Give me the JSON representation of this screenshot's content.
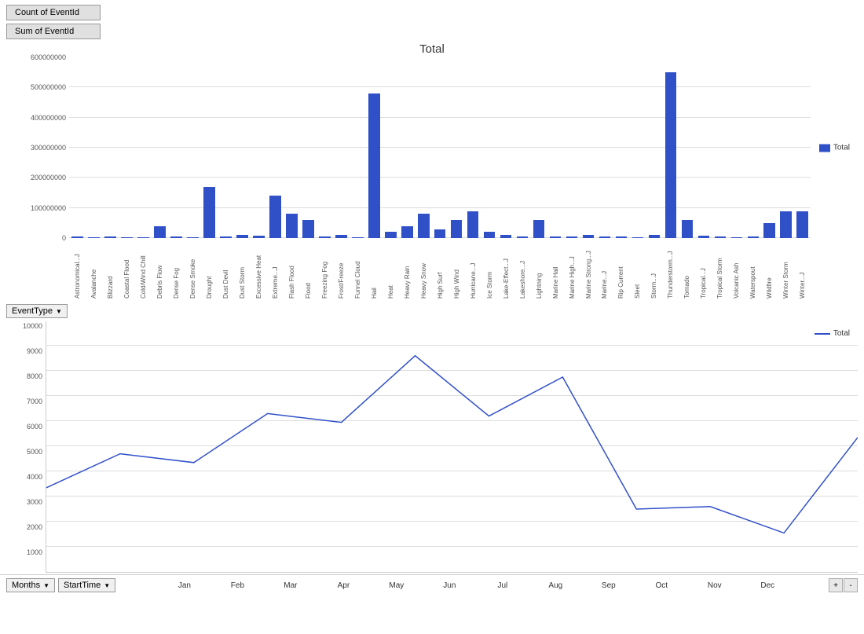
{
  "topButtons": {
    "countLabel": "Count of EventId",
    "sumLabel": "Sum of EventId"
  },
  "barChart": {
    "title": "Total",
    "legendLabel": "Total",
    "yAxisLabels": [
      "600000000",
      "500000000",
      "400000000",
      "300000000",
      "200000000",
      "100000000",
      "0"
    ],
    "yMax": 600000000,
    "categories": [
      {
        "name": "Astronomical...J",
        "value": 5000000
      },
      {
        "name": "Avalanche",
        "value": 3000000
      },
      {
        "name": "Blizzard",
        "value": 4000000
      },
      {
        "name": "Coastal Flood",
        "value": 3000000
      },
      {
        "name": "Cold/Wind Chill",
        "value": 3000000
      },
      {
        "name": "Debris Flow",
        "value": 40000000
      },
      {
        "name": "Dense Fog",
        "value": 5000000
      },
      {
        "name": "Dense Smoke",
        "value": 3000000
      },
      {
        "name": "Drought",
        "value": 170000000
      },
      {
        "name": "Dust Devil",
        "value": 4000000
      },
      {
        "name": "Dust Storm",
        "value": 10000000
      },
      {
        "name": "Excessive Heat",
        "value": 8000000
      },
      {
        "name": "Extreme...J",
        "value": 140000000
      },
      {
        "name": "Flash Flood",
        "value": 80000000
      },
      {
        "name": "Flood",
        "value": 60000000
      },
      {
        "name": "Freezing Fog",
        "value": 4000000
      },
      {
        "name": "Frost/Freeze",
        "value": 10000000
      },
      {
        "name": "Funnel Cloud",
        "value": 3000000
      },
      {
        "name": "Hail",
        "value": 480000000
      },
      {
        "name": "Heat",
        "value": 20000000
      },
      {
        "name": "Heavy Rain",
        "value": 40000000
      },
      {
        "name": "Heavy Snow",
        "value": 80000000
      },
      {
        "name": "High Surf",
        "value": 30000000
      },
      {
        "name": "High Wind",
        "value": 60000000
      },
      {
        "name": "Hurricane...J",
        "value": 90000000
      },
      {
        "name": "Ice Storm",
        "value": 20000000
      },
      {
        "name": "Lake-Effect...J",
        "value": 10000000
      },
      {
        "name": "Lakeshore...J",
        "value": 5000000
      },
      {
        "name": "Lightning",
        "value": 60000000
      },
      {
        "name": "Marine Hail",
        "value": 5000000
      },
      {
        "name": "Marine High...J",
        "value": 5000000
      },
      {
        "name": "Marine Strong...J",
        "value": 10000000
      },
      {
        "name": "Marine...J",
        "value": 5000000
      },
      {
        "name": "Rip Current",
        "value": 4000000
      },
      {
        "name": "Sleet",
        "value": 3000000
      },
      {
        "name": "Storm...J",
        "value": 10000000
      },
      {
        "name": "Thunderstorm...J",
        "value": 550000000
      },
      {
        "name": "Tornado",
        "value": 60000000
      },
      {
        "name": "Tropical...J",
        "value": 8000000
      },
      {
        "name": "Tropical Storm",
        "value": 5000000
      },
      {
        "name": "Volcanic Ash",
        "value": 3000000
      },
      {
        "name": "Waterspout",
        "value": 5000000
      },
      {
        "name": "Wildfire",
        "value": 50000000
      },
      {
        "name": "Winter Storm",
        "value": 90000000
      },
      {
        "name": "Winter...J",
        "value": 90000000
      }
    ]
  },
  "eventTypeDropdown": "EventType",
  "lineChart": {
    "legendLabel": "Total",
    "yAxisLabels": [
      "10000",
      "9000",
      "8000",
      "7000",
      "6000",
      "5000",
      "4000",
      "3000",
      "2000",
      "1000",
      ""
    ],
    "yMax": 10000,
    "dataPoints": [
      {
        "month": "Jan",
        "value": 3350
      },
      {
        "month": "Feb",
        "value": 4700
      },
      {
        "month": "Mar",
        "value": 4350
      },
      {
        "month": "Apr",
        "value": 6300
      },
      {
        "month": "May",
        "value": 5950
      },
      {
        "month": "Jun",
        "value": 8600
      },
      {
        "month": "Jul",
        "value": 6200
      },
      {
        "month": "Aug",
        "value": 7750
      },
      {
        "month": "Sep",
        "value": 2500
      },
      {
        "month": "Oct",
        "value": 2600
      },
      {
        "month": "Nov",
        "value": 1550
      },
      {
        "month": "Dec",
        "value": 5350
      }
    ]
  },
  "bottomControls": {
    "monthsLabel": "Months",
    "startTimeLabel": "StartTime",
    "xLabels": [
      "Jan",
      "Feb",
      "Mar",
      "Apr",
      "May",
      "Jun",
      "Jul",
      "Aug",
      "Sep",
      "Oct",
      "Nov",
      "Dec"
    ],
    "scrollPrevLabel": "+",
    "scrollNextLabel": "-"
  }
}
